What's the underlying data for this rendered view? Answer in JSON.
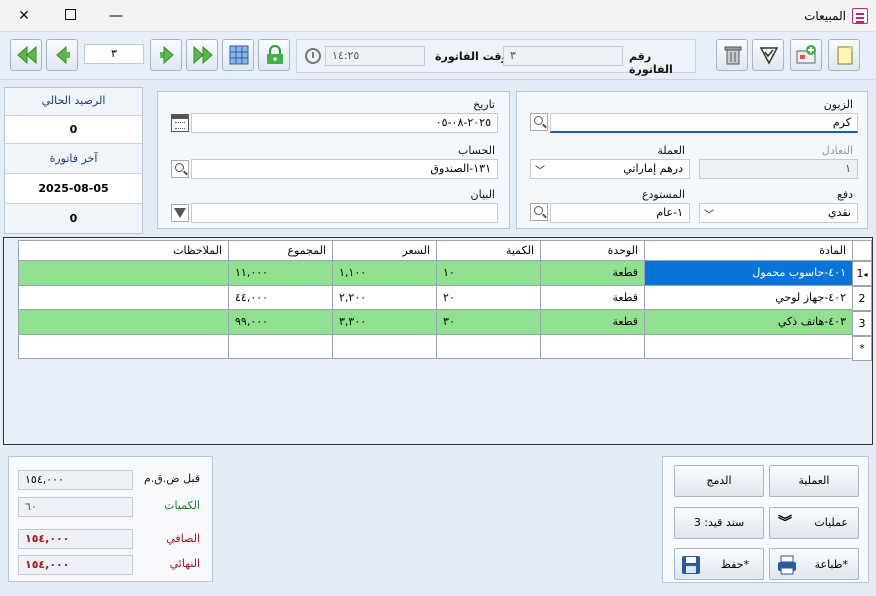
{
  "window": {
    "title": "المبيعات"
  },
  "toolbar": {
    "page_number": "٣",
    "invoice_time_label": "وقت الفاتورة",
    "invoice_time": "١٤:٢٥",
    "invoice_number_label": "رقم الفاتورة",
    "invoice_number": "٣"
  },
  "side": {
    "current_balance_label": "الرصيد الحالي",
    "current_balance": "0",
    "last_invoice_label": "آخر فاتورة",
    "last_invoice_date": "2025-08-05",
    "last_invoice_value": "0"
  },
  "form": {
    "customer_label": "الزبون",
    "customer": "كرم",
    "exchange_label": "التعادل",
    "exchange": "١",
    "currency_label": "العملة",
    "currency": "درهم إماراتي",
    "payment_label": "دفع",
    "payment": "نقدي",
    "warehouse_label": "المستودع",
    "warehouse": "١-عام",
    "date_label": "تاريخ",
    "date": "٢٠٢٥-٠٨-٠٥",
    "account_label": "الحساب",
    "account": "١٣١-الصندوق",
    "statement_label": "البيان",
    "statement": ""
  },
  "grid": {
    "columns": [
      "المادة",
      "الوحدة",
      "الكمية",
      "السعر",
      "المجموع",
      "الملاحظات"
    ],
    "rows": [
      {
        "indicator": "1",
        "item": "٤٠١-حاسوب محمول",
        "unit": "قطعة",
        "qty": "١٠",
        "price": "١,١٠٠",
        "total": "١١,٠٠٠",
        "notes": ""
      },
      {
        "indicator": "2",
        "item": "٤٠٢-جهاز لوحي",
        "unit": "قطعة",
        "qty": "٢٠",
        "price": "٢,٢٠٠",
        "total": "٤٤,٠٠٠",
        "notes": ""
      },
      {
        "indicator": "3",
        "item": "٤٠٣-هاتف ذكي",
        "unit": "قطعة",
        "qty": "٣٠",
        "price": "٣,٣٠٠",
        "total": "٩٩,٠٠٠",
        "notes": ""
      }
    ],
    "new_row_indicator": "*"
  },
  "totals": {
    "before_tax_label": "قبل ض.ق.م",
    "before_tax": "١٥٤,٠٠٠",
    "quantities_label": "الكميات",
    "quantities": "٦٠",
    "net_label": "الصافي",
    "net": "١٥٤,٠٠٠",
    "final_label": "النهائي",
    "final": "١٥٤,٠٠٠"
  },
  "actions": {
    "operation": "العملية",
    "merge": "الدمج",
    "operations": "عمليات",
    "journal_voucher": "سند قيد: 3",
    "print": "طباعة*",
    "save": "حفظ*"
  },
  "colors": {
    "green_row": "#90e090",
    "selected": "#0a74d6",
    "accent": "#4caf50"
  }
}
